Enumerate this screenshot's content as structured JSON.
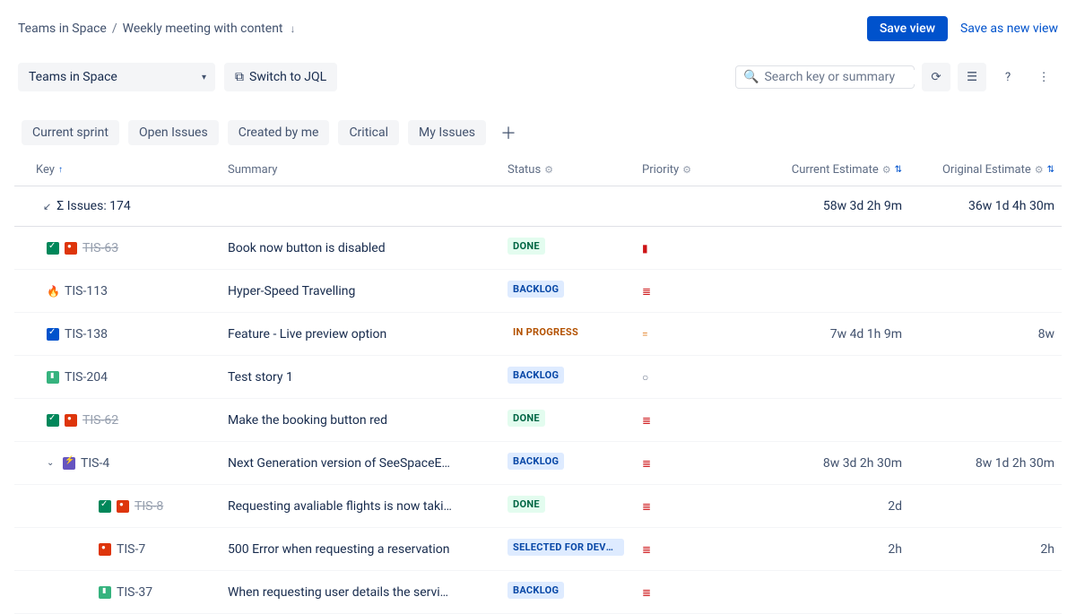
{
  "breadcrumb": {
    "root": "Teams in Space",
    "current": "Weekly meeting with content"
  },
  "actions": {
    "save_view": "Save view",
    "save_as_new": "Save as new view"
  },
  "controls": {
    "project_selected": "Teams in Space",
    "switch_jql": "Switch to JQL"
  },
  "search": {
    "placeholder": "Search key or summary"
  },
  "filters": [
    "Current sprint",
    "Open Issues",
    "Created by me",
    "Critical",
    "My Issues"
  ],
  "columns": {
    "key": "Key",
    "summary": "Summary",
    "status": "Status",
    "priority": "Priority",
    "current_estimate": "Current Estimate",
    "original_estimate": "Original Estimate"
  },
  "totals": {
    "label": "Σ Issues: 174",
    "current_estimate": "58w 3d 2h 9m",
    "original_estimate": "36w 1d 4h 30m"
  },
  "rows": [
    {
      "indent": 1,
      "icons": [
        "check",
        "bug"
      ],
      "key": "TIS-63",
      "strike": true,
      "summary": "Book now button is disabled",
      "status": "DONE",
      "status_class": "DONE",
      "priority": "highest",
      "prio_glyph": "▮",
      "e1": "",
      "e2": ""
    },
    {
      "indent": 1,
      "icons": [
        "fire"
      ],
      "key": "TIS-113",
      "strike": false,
      "summary": "Hyper-Speed Travelling",
      "status": "BACKLOG",
      "status_class": "BACKLOG",
      "priority": "highest",
      "prio_glyph": "≣",
      "e1": "",
      "e2": ""
    },
    {
      "indent": 1,
      "icons": [
        "task"
      ],
      "key": "TIS-138",
      "strike": false,
      "summary": "Feature - Live preview option",
      "status": "IN PROGRESS",
      "status_class": "INPROGRESS",
      "priority": "medium",
      "prio_glyph": "=",
      "e1": "7w 4d 1h 9m",
      "e2": "8w"
    },
    {
      "indent": 1,
      "icons": [
        "story"
      ],
      "key": "TIS-204",
      "strike": false,
      "summary": "Test story 1",
      "status": "BACKLOG",
      "status_class": "BACKLOG",
      "priority": "none",
      "prio_glyph": "○",
      "e1": "",
      "e2": ""
    },
    {
      "indent": 1,
      "icons": [
        "check",
        "bug"
      ],
      "key": "TIS-62",
      "strike": true,
      "summary": "Make the booking button red",
      "status": "DONE",
      "status_class": "DONE",
      "priority": "highest",
      "prio_glyph": "≣",
      "e1": "",
      "e2": ""
    },
    {
      "indent": 1,
      "caret": true,
      "icons": [
        "epic"
      ],
      "key": "TIS-4",
      "strike": false,
      "summary": "Next Generation version of SeeSpaceE…",
      "status": "BACKLOG",
      "status_class": "BACKLOG",
      "priority": "highest",
      "prio_glyph": "≣",
      "e1": "8w 3d 2h 30m",
      "e2": "8w 1d 2h 30m"
    },
    {
      "indent": 3,
      "icons": [
        "check",
        "bug"
      ],
      "key": "TIS-8",
      "strike": true,
      "summary": "Requesting avaliable flights is now taki…",
      "status": "DONE",
      "status_class": "DONE",
      "priority": "highest",
      "prio_glyph": "≣",
      "e1": "2d",
      "e2": ""
    },
    {
      "indent": 3,
      "icons": [
        "bug"
      ],
      "key": "TIS-7",
      "strike": false,
      "summary": "500 Error when requesting a reservation",
      "status": "SELECTED FOR DEVEL…",
      "status_class": "SELECTED",
      "priority": "highest",
      "prio_glyph": "≣",
      "e1": "2h",
      "e2": "2h"
    },
    {
      "indent": 3,
      "icons": [
        "story"
      ],
      "key": "TIS-37",
      "strike": false,
      "summary": "When requesting user details the servi…",
      "status": "BACKLOG",
      "status_class": "BACKLOG",
      "priority": "highest",
      "prio_glyph": "≣",
      "e1": "",
      "e2": ""
    }
  ]
}
